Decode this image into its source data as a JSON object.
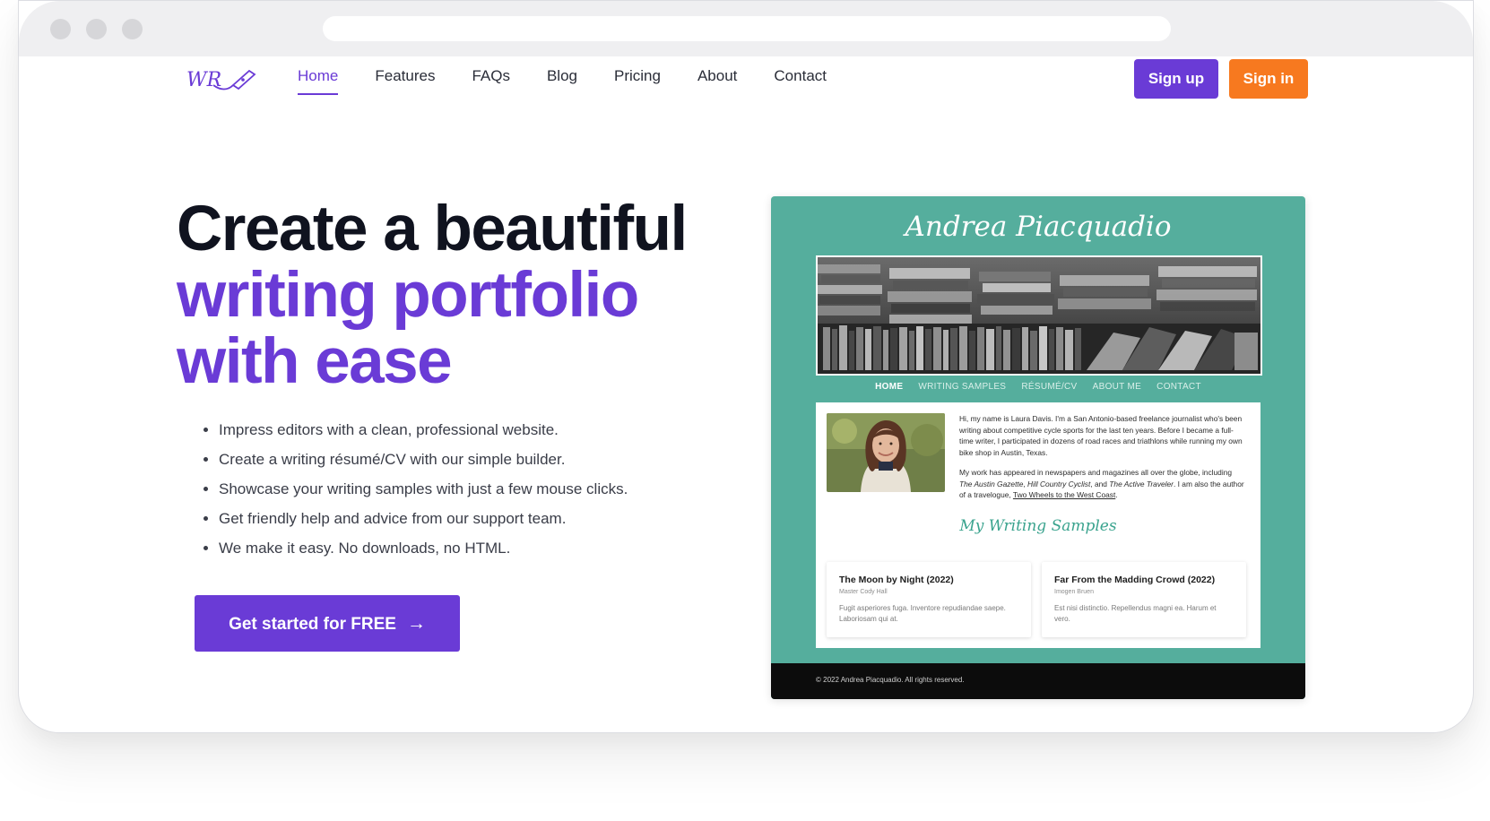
{
  "browser": {
    "address_bar": ""
  },
  "nav": {
    "items": [
      {
        "label": "Home",
        "active": true
      },
      {
        "label": "Features",
        "active": false
      },
      {
        "label": "FAQs",
        "active": false
      },
      {
        "label": "Blog",
        "active": false
      },
      {
        "label": "Pricing",
        "active": false
      },
      {
        "label": "About",
        "active": false
      },
      {
        "label": "Contact",
        "active": false
      }
    ],
    "signup_label": "Sign up",
    "signin_label": "Sign in"
  },
  "logo": {
    "text": "WR",
    "icon": "pen-nib-icon"
  },
  "hero": {
    "title_line1": "Create a beautiful",
    "title_line2": "writing portfolio",
    "title_line3": "with ease",
    "bullets": [
      "Impress editors with a clean, professional website.",
      "Create a writing résumé/CV with our simple builder.",
      "Showcase your writing samples with just a few mouse clicks.",
      "Get friendly help and advice from our support team.",
      "We make it easy. No downloads, no HTML."
    ],
    "cta_label": "Get started for FREE",
    "cta_arrow": "→"
  },
  "preview": {
    "name": "Andrea Piacquadio",
    "nav": [
      "HOME",
      "WRITING SAMPLES",
      "RÉSUMÉ/CV",
      "ABOUT ME",
      "CONTACT"
    ],
    "bio_p1": "Hi, my name is Laura Davis. I'm a San Antonio-based freelance journalist who's been writing about competitive cycle sports for the last ten years. Before I became a full-time writer, I participated in dozens of road races and triathlons while running my own bike shop in Austin, Texas.",
    "bio_p2_a": "My work has appeared in newspapers and magazines all over the globe, including ",
    "bio_p2_pub1": "The Austin Gazette",
    "bio_p2_sep1": ", ",
    "bio_p2_pub2": "Hill Country Cyclist",
    "bio_p2_sep2": ", and ",
    "bio_p2_pub3": "The Active Traveler",
    "bio_p2_b": ". I am also the author of a travelogue, ",
    "bio_p2_book": "Two Wheels to the West Coast",
    "bio_p2_end": ".",
    "samples_heading": "My Writing Samples",
    "samples": [
      {
        "title": "The Moon by Night (2022)",
        "author": "Master Cody Hall",
        "excerpt": "Fugit asperiores fuga. Inventore repudiandae saepe. Laboriosam qui at."
      },
      {
        "title": "Far From the Madding Crowd (2022)",
        "author": "Imogen Bruen",
        "excerpt": "Est nisi distinctio. Repellendus magni ea. Harum et vero."
      }
    ],
    "footer": "© 2022 Andrea Piacquadio. All rights reserved."
  },
  "colors": {
    "brand_purple": "#6a3bd6",
    "brand_orange": "#f7791f",
    "preview_teal": "#55ae9d"
  }
}
